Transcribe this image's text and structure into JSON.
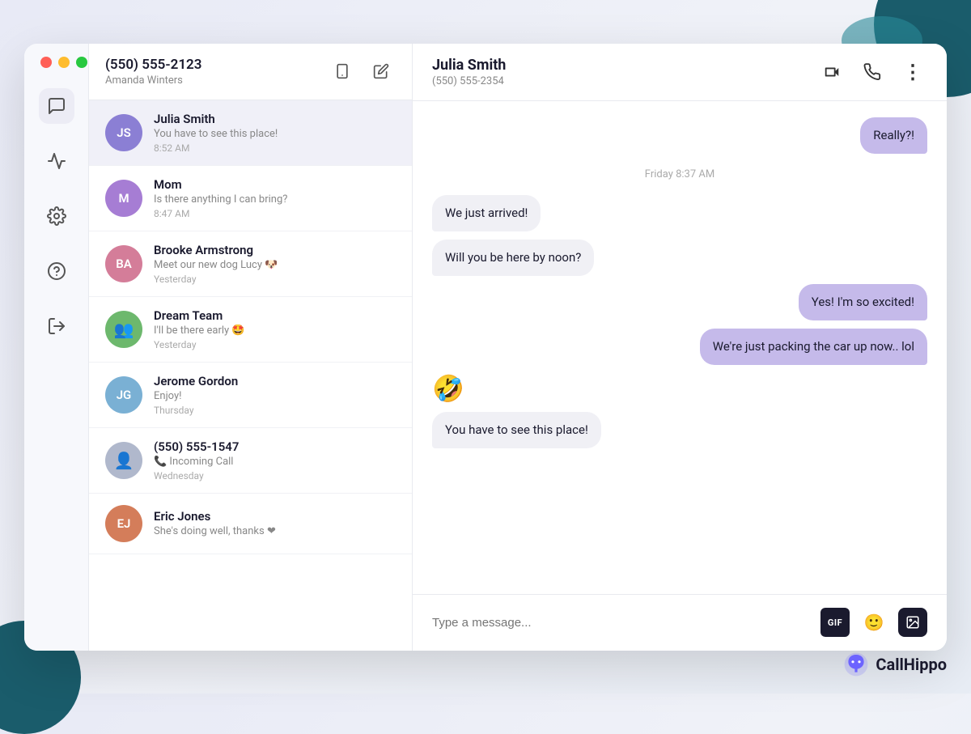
{
  "window": {
    "controls": [
      "red",
      "yellow",
      "green"
    ]
  },
  "sidebar": {
    "icons": [
      {
        "name": "messages-icon",
        "symbol": "💬"
      },
      {
        "name": "activity-icon",
        "symbol": "⚡"
      },
      {
        "name": "settings-icon",
        "symbol": "⚙"
      },
      {
        "name": "help-icon",
        "symbol": "?"
      },
      {
        "name": "logout-icon",
        "symbol": "↩"
      }
    ]
  },
  "conversations_panel": {
    "header": {
      "phone": "(550) 555-2123",
      "name": "Amanda Winters",
      "actions": [
        {
          "name": "dialpad-icon",
          "symbol": "⌨"
        },
        {
          "name": "compose-icon",
          "symbol": "✏"
        }
      ]
    },
    "conversations": [
      {
        "id": "julia-smith",
        "initials": "JS",
        "avatar_class": "avatar-js",
        "contact_name": "Julia Smith",
        "preview": "You have to see this place!",
        "time": "8:52 AM",
        "active": true
      },
      {
        "id": "mom",
        "initials": "M",
        "avatar_class": "avatar-m",
        "contact_name": "Mom",
        "preview": "Is there anything I can bring?",
        "time": "8:47 AM",
        "active": false
      },
      {
        "id": "brooke-armstrong",
        "initials": "BA",
        "avatar_class": "avatar-ba",
        "contact_name": "Brooke Armstrong",
        "preview": "Meet our new dog Lucy 🐶",
        "time": "Yesterday",
        "active": false
      },
      {
        "id": "dream-team",
        "initials": "👥",
        "avatar_class": "avatar-dt",
        "contact_name": "Dream Team",
        "preview": "I'll be there early 🤩",
        "time": "Yesterday",
        "active": false
      },
      {
        "id": "jerome-gordon",
        "initials": "JG",
        "avatar_class": "avatar-jg",
        "contact_name": "Jerome Gordon",
        "preview": "Enjoy!",
        "time": "Thursday",
        "active": false
      },
      {
        "id": "unknown-caller",
        "initials": "👤",
        "avatar_class": "avatar-phone",
        "contact_name": "(550) 555-1547",
        "preview": "📞 Incoming Call",
        "time": "Wednesday",
        "active": false
      },
      {
        "id": "eric-jones",
        "initials": "EJ",
        "avatar_class": "avatar-ej",
        "contact_name": "Eric Jones",
        "preview": "She's doing well, thanks ❤",
        "time": "",
        "active": false
      }
    ]
  },
  "chat_panel": {
    "header": {
      "contact_name": "Julia Smith",
      "contact_phone": "(550) 555-2354",
      "actions": [
        {
          "name": "video-icon",
          "symbol": "📹"
        },
        {
          "name": "call-icon",
          "symbol": "📞"
        },
        {
          "name": "more-icon",
          "symbol": "⋮"
        }
      ]
    },
    "messages": [
      {
        "id": "msg-1",
        "type": "outgoing",
        "text": "Really?!",
        "timestamp": null
      },
      {
        "id": "ts-friday",
        "type": "timestamp",
        "text": "Friday 8:37 AM"
      },
      {
        "id": "msg-2",
        "type": "incoming",
        "text": "We just arrived!",
        "timestamp": null
      },
      {
        "id": "msg-3",
        "type": "incoming",
        "text": "Will you be here by noon?",
        "timestamp": null
      },
      {
        "id": "msg-4",
        "type": "outgoing",
        "text": "Yes! I'm so excited!",
        "timestamp": null
      },
      {
        "id": "msg-5",
        "type": "outgoing",
        "text": "We're just packing the car up now.. lol",
        "timestamp": null
      },
      {
        "id": "msg-6",
        "type": "emoji",
        "text": "🤣",
        "timestamp": null
      },
      {
        "id": "msg-7",
        "type": "incoming",
        "text": "You have to see this place!",
        "timestamp": null
      }
    ],
    "input": {
      "placeholder": "Type a message...",
      "actions": [
        {
          "name": "gif-button",
          "label": "GIF"
        },
        {
          "name": "emoji-button",
          "label": "😊"
        },
        {
          "name": "image-button",
          "label": "🖼"
        }
      ]
    }
  },
  "branding": {
    "name": "CallHippo"
  }
}
